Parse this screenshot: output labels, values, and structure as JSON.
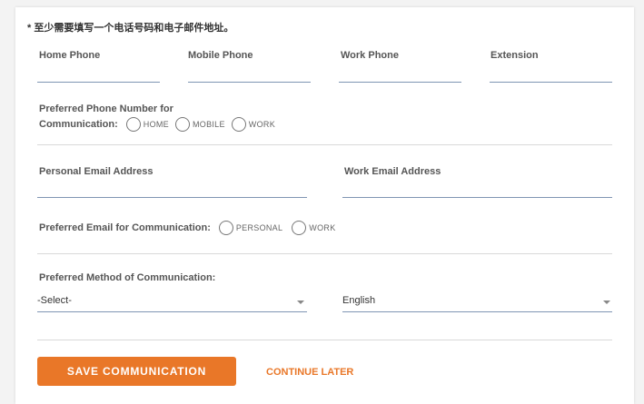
{
  "note": "* 至少需要填写一个电话号码和电子邮件地址。",
  "phone_fields": {
    "home": {
      "label": "Home Phone",
      "value": ""
    },
    "mobile": {
      "label": "Mobile Phone",
      "value": ""
    },
    "work": {
      "label": "Work Phone",
      "value": ""
    },
    "extension": {
      "label": "Extension",
      "value": ""
    }
  },
  "preferred_phone": {
    "label_line1": "Preferred Phone Number for",
    "label_line2": "Communication:",
    "options": [
      "HOME",
      "MOBILE",
      "WORK"
    ]
  },
  "email_fields": {
    "personal": {
      "label": "Personal Email Address",
      "value": ""
    },
    "work": {
      "label": "Work Email Address",
      "value": ""
    }
  },
  "preferred_email": {
    "label": "Preferred Email for Communication:",
    "options": [
      "PERSONAL",
      "WORK"
    ]
  },
  "preferred_method": {
    "label": "Preferred Method of Communication:",
    "method_select_value": "-Select-",
    "language_select_value": "English"
  },
  "actions": {
    "save_label": "SAVE COMMUNICATION",
    "continue_label": "CONTINUE LATER"
  },
  "colors": {
    "accent": "#e97728",
    "field_underline": "#7f95b3",
    "divider": "#d9d9d9"
  }
}
